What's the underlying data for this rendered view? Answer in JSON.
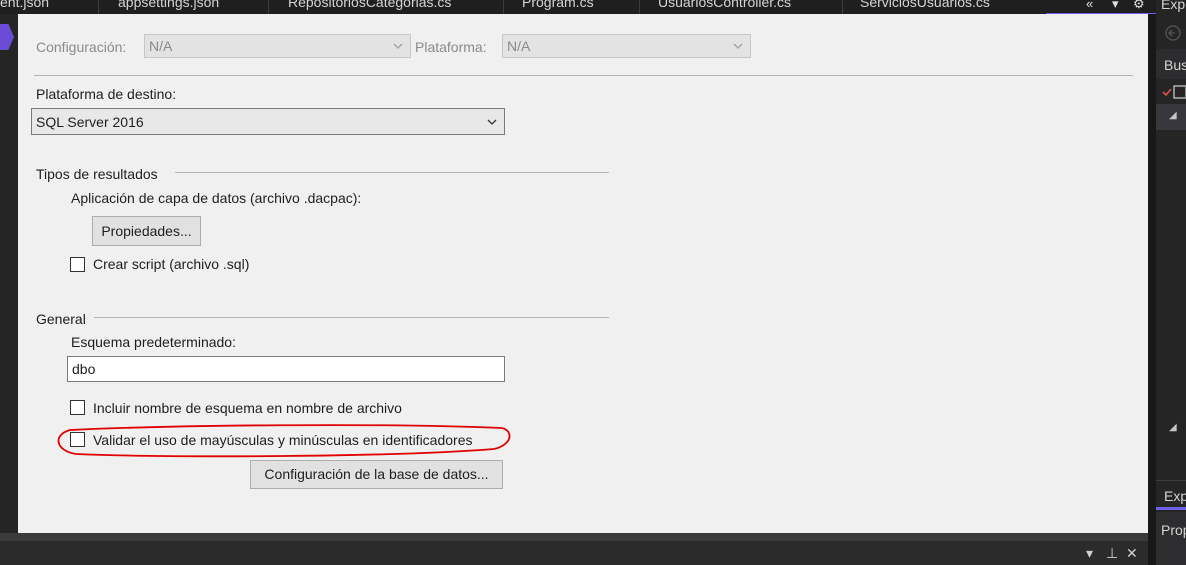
{
  "tabs": [
    "ent.json",
    "appsettings.json",
    "RepositoriosCategorias.cs",
    "Program.cs",
    "UsuariosController.cs",
    "ServiciosUsuarios.cs"
  ],
  "tab_controls": {
    "overflow": "«",
    "dropdown": "▾",
    "settings": "⚙"
  },
  "config": {
    "configuracion_label": "Configuración:",
    "configuracion_value": "N/A",
    "plataforma_label": "Plataforma:",
    "plataforma_value": "N/A"
  },
  "destino": {
    "label": "Plataforma de destino:",
    "value": "SQL Server 2016"
  },
  "tipos": {
    "heading": "Tipos de resultados",
    "dacpac_label": "Aplicación de capa de datos (archivo .dacpac):",
    "propiedades_button": "Propiedades...",
    "crear_script_label": "Crear script (archivo .sql)",
    "crear_script_checked": false
  },
  "general": {
    "heading": "General",
    "esquema_label": "Esquema predeterminado:",
    "esquema_value": "dbo",
    "incluir_label": "Incluir nombre de esquema en nombre de archivo",
    "incluir_checked": false,
    "validar_label": "Validar el uso de mayúsculas y minúsculas en identificadores",
    "validar_checked": false,
    "config_bd_button": "Configuración de la base de datos..."
  },
  "right_panel": {
    "top_label": "Exp",
    "search_label": "Bus",
    "bottom_label": "Exp",
    "props_label": "Prop"
  },
  "bottom_controls": {
    "dropdown": "▾",
    "pin": "⊥",
    "close": "✕"
  },
  "colors": {
    "accent": "#7160e8",
    "annotation": "#e00000"
  }
}
